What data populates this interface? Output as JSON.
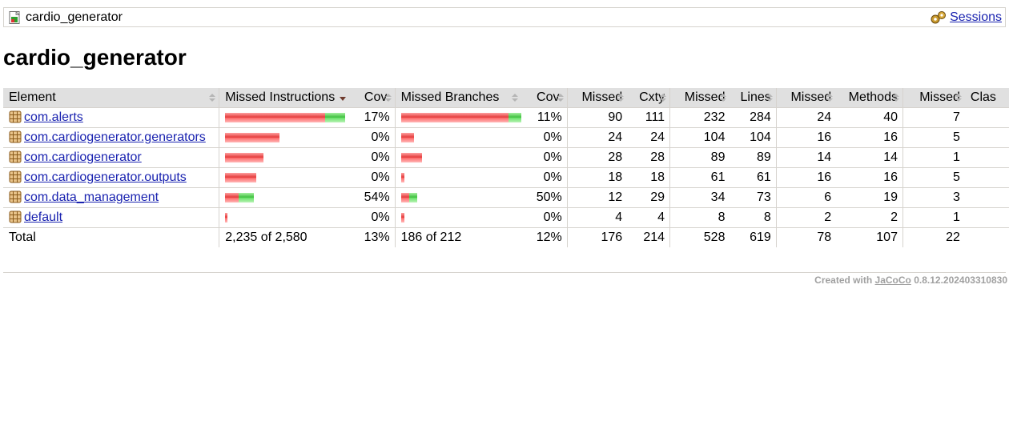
{
  "breadcrumb": {
    "report_name": "cardio_generator",
    "sessions_link": "Sessions"
  },
  "page_title": "cardio_generator",
  "table": {
    "headers": [
      "Element",
      "Missed Instructions",
      "Cov.",
      "Missed Branches",
      "Cov.",
      "Missed",
      "Cxty",
      "Missed",
      "Lines",
      "Missed",
      "Methods",
      "Missed",
      "Clas"
    ],
    "sorted_column": "Missed Instructions",
    "rows": [
      {
        "name": "com.alerts",
        "instr_missed_fraction": 0.83,
        "instr_total_rel": 1.0,
        "instr_cov": "17%",
        "branch_missed_fraction": 0.89,
        "branch_total_rel": 1.0,
        "branch_cov": "11%",
        "cxty_missed": "90",
        "cxty": "111",
        "lines_missed": "232",
        "lines": "284",
        "methods_missed": "24",
        "methods": "40",
        "classes_missed": "7"
      },
      {
        "name": "com.cardiogenerator.generators",
        "instr_missed_fraction": 1.0,
        "instr_total_rel": 0.453,
        "instr_cov": "0%",
        "branch_missed_fraction": 1.0,
        "branch_total_rel": 0.107,
        "branch_cov": "0%",
        "cxty_missed": "24",
        "cxty": "24",
        "lines_missed": "104",
        "lines": "104",
        "methods_missed": "16",
        "methods": "16",
        "classes_missed": "5"
      },
      {
        "name": "com.cardiogenerator",
        "instr_missed_fraction": 1.0,
        "instr_total_rel": 0.32,
        "instr_cov": "0%",
        "branch_missed_fraction": 1.0,
        "branch_total_rel": 0.173,
        "branch_cov": "0%",
        "cxty_missed": "28",
        "cxty": "28",
        "lines_missed": "89",
        "lines": "89",
        "methods_missed": "14",
        "methods": "14",
        "classes_missed": "1"
      },
      {
        "name": "com.cardiogenerator.outputs",
        "instr_missed_fraction": 1.0,
        "instr_total_rel": 0.26,
        "instr_cov": "0%",
        "branch_missed_fraction": 1.0,
        "branch_total_rel": 0.027,
        "branch_cov": "0%",
        "cxty_missed": "18",
        "cxty": "18",
        "lines_missed": "61",
        "lines": "61",
        "methods_missed": "16",
        "methods": "16",
        "classes_missed": "5"
      },
      {
        "name": "com.data_management",
        "instr_missed_fraction": 0.46,
        "instr_total_rel": 0.24,
        "instr_cov": "54%",
        "branch_missed_fraction": 0.5,
        "branch_total_rel": 0.133,
        "branch_cov": "50%",
        "cxty_missed": "12",
        "cxty": "29",
        "lines_missed": "34",
        "lines": "73",
        "methods_missed": "6",
        "methods": "19",
        "classes_missed": "3"
      },
      {
        "name": "default",
        "instr_missed_fraction": 1.0,
        "instr_total_rel": 0.02,
        "instr_cov": "0%",
        "branch_missed_fraction": 1.0,
        "branch_total_rel": 0.027,
        "branch_cov": "0%",
        "cxty_missed": "4",
        "cxty": "4",
        "lines_missed": "8",
        "lines": "8",
        "methods_missed": "2",
        "methods": "2",
        "classes_missed": "1"
      }
    ],
    "total": {
      "label": "Total",
      "instr": "2,235 of 2,580",
      "instr_cov": "13%",
      "branch": "186 of 212",
      "branch_cov": "12%",
      "cxty_missed": "176",
      "cxty": "214",
      "lines_missed": "528",
      "lines": "619",
      "methods_missed": "78",
      "methods": "107",
      "classes_missed": "22"
    }
  },
  "footer": {
    "prefix": "Created with",
    "link": "JaCoCo",
    "version": "0.8.12.202403310830"
  },
  "colors": {
    "missed": "#e33b3b",
    "covered": "#3fbf3f",
    "header_bg": "#e0e0e0",
    "link": "#1a23b0"
  }
}
